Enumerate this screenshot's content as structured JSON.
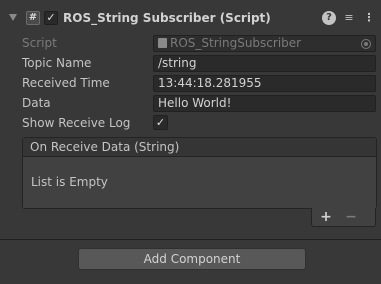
{
  "component": {
    "title": "ROS_String Subscriber (Script)",
    "enabled": true,
    "script_icon_glyph": "#",
    "check_glyph": "✓",
    "help_glyph": "?",
    "presets_glyph": "≡",
    "menu_glyph": "⋮"
  },
  "fields": {
    "script": {
      "label": "Script",
      "value": "ROS_StringSubscriber"
    },
    "topic_name": {
      "label": "Topic Name",
      "value": "/string"
    },
    "received_time": {
      "label": "Received Time",
      "value": "13:44:18.281955"
    },
    "data": {
      "label": "Data",
      "value": "Hello World!"
    },
    "show_receive_log": {
      "label": "Show Receive Log",
      "checked": true,
      "glyph": "✓"
    }
  },
  "list": {
    "header": "On Receive Data (String)",
    "empty_text": "List is Empty",
    "add_glyph": "+",
    "remove_glyph": "−"
  },
  "add_component": {
    "label": "Add Component"
  },
  "colors": {
    "background": "#383838",
    "field_bg": "#2a2a2a",
    "button_bg": "#585858",
    "text": "#c4c4c4"
  }
}
